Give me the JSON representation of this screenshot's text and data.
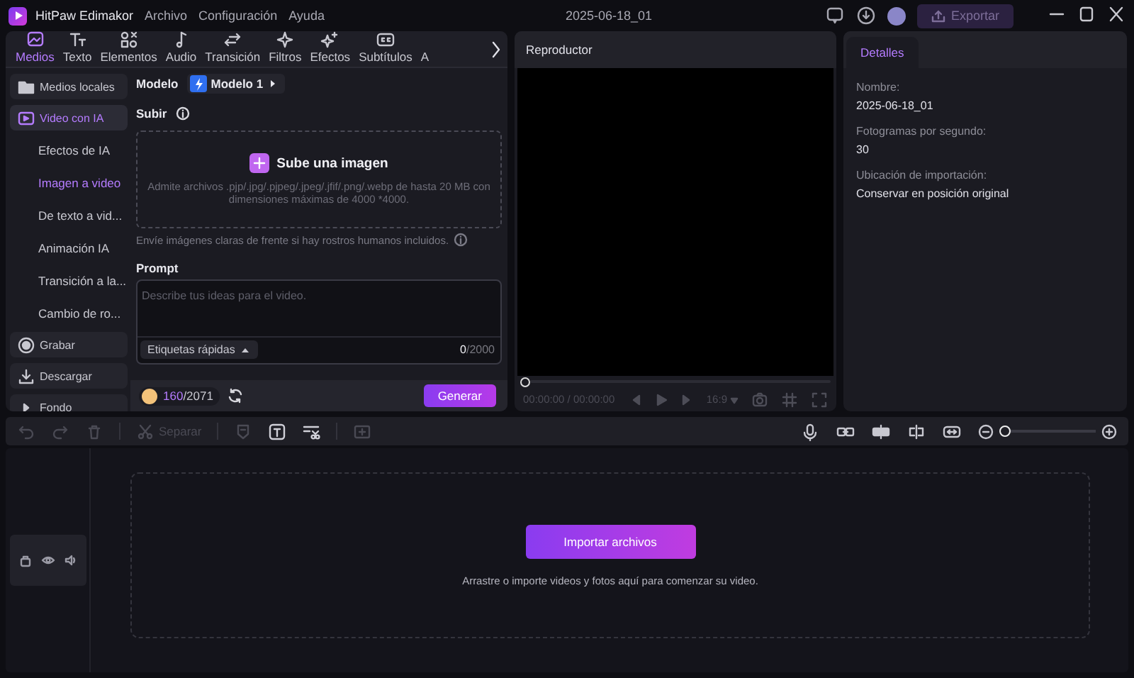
{
  "window": {
    "app_name": "HitPaw Edimakor",
    "menu": [
      "Archivo",
      "Configuración",
      "Ayuda"
    ],
    "project_title": "2025-06-18_01",
    "export_button": {
      "label": "Exportar",
      "disabled": true
    }
  },
  "toolbar_tabs": [
    {
      "label": "Medios",
      "selected": true
    },
    {
      "label": "Texto",
      "selected": false
    },
    {
      "label": "Elementos",
      "selected": false
    },
    {
      "label": "Audio",
      "selected": false
    },
    {
      "label": "Transición",
      "selected": false
    },
    {
      "label": "Filtros",
      "selected": false
    },
    {
      "label": "Efectos",
      "selected": false
    },
    {
      "label": "Subtítulos",
      "selected": false
    },
    {
      "label": "A",
      "selected": false
    }
  ],
  "sidebar": {
    "items": [
      {
        "label": "Medios locales",
        "kind": "folder",
        "selected": false
      },
      {
        "label": "Video con IA",
        "kind": "ai",
        "selected": true,
        "children": [
          {
            "label": "Efectos de IA",
            "selected": false
          },
          {
            "label": "Imagen a video",
            "selected": true
          },
          {
            "label": "De texto a vid...",
            "selected": false
          },
          {
            "label": "Animación IA",
            "selected": false
          },
          {
            "label": "Transición a la...",
            "selected": false
          },
          {
            "label": "Cambio de ro...",
            "selected": false
          }
        ]
      },
      {
        "label": "Grabar",
        "kind": "record",
        "selected": false
      },
      {
        "label": "Descargar",
        "kind": "download",
        "selected": false
      },
      {
        "label": "Fondo",
        "kind": "caret",
        "selected": false
      }
    ]
  },
  "generator": {
    "model_label": "Modelo",
    "model": "Modelo 1",
    "upload_label": "Subir",
    "upload_button": "Sube una imagen",
    "upload_hint": "Admite archivos .pjp/.jpg/.pjpeg/.jpeg/.jfif/.png/.webp de hasta 20 MB con dimensiones máximas de 4000 *4000.",
    "upload_note": "Envíe imágenes claras de frente si hay rostros humanos incluidos.",
    "prompt_label": "Prompt",
    "prompt_placeholder": "Describe tus ideas para el video.",
    "quick_tags": "Etiquetas rápidas",
    "char_count": "**0**/2000",
    "credits_used": "160",
    "credits_total": "/2071",
    "generate_button": "Generar"
  },
  "player": {
    "title": "Reproductor",
    "progress": {
      "level": 0
    },
    "time": "00:00:00 / 00:00:00",
    "aspect_ratio": "16:9"
  },
  "details": {
    "tab": {
      "label": "Detalles",
      "selected": true
    },
    "fields": [
      {
        "label": "Nombre:",
        "value": "2025-06-18_01"
      },
      {
        "label": "Fotogramas por segundo:",
        "value": "30"
      },
      {
        "label": "Ubicación de importación:",
        "value": "Conservar en posición original"
      }
    ]
  },
  "timeline_toolbar": {
    "tools": [
      {
        "kind": "undo",
        "disabled": true
      },
      {
        "kind": "redo",
        "disabled": true
      },
      {
        "kind": "delete",
        "disabled": true
      },
      {
        "kind": "split",
        "label": "Separar",
        "disabled": true
      },
      {
        "kind": "marker",
        "disabled": true
      },
      {
        "kind": "text",
        "disabled": false
      },
      {
        "kind": "cut",
        "disabled": false
      },
      {
        "kind": "add",
        "disabled": true
      }
    ],
    "zoom": {
      "level": 0
    }
  },
  "timeline": {
    "import_button": "Importar archivos",
    "hint": "Arrastre o importe videos y fotos aquí para comenzar su video."
  }
}
